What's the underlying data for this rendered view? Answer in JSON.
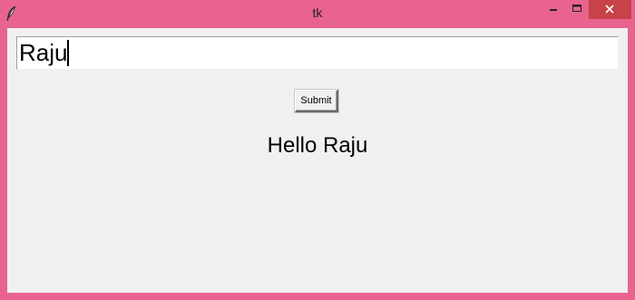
{
  "window": {
    "title": "tk",
    "icons": {
      "app": "feather-icon",
      "minimize": "minimize-icon",
      "maximize": "maximize-icon",
      "close": "close-icon"
    },
    "colors": {
      "frame": "#e8648f",
      "close_hover": "#c74249",
      "client_bg": "#f0f0f0"
    }
  },
  "form": {
    "entry_value": "Raju",
    "submit_label": "Submit",
    "output_text": "Hello Raju"
  }
}
